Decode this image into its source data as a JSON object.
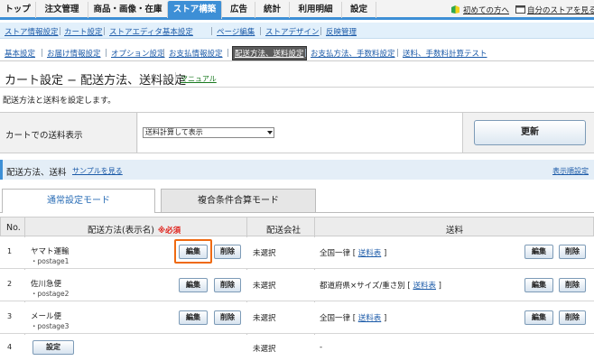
{
  "topnav": {
    "tabs": [
      {
        "label": "トップ"
      },
      {
        "label": "注文管理"
      },
      {
        "label": "商品・画像・在庫"
      },
      {
        "label": "ストア構築"
      },
      {
        "label": "広告"
      },
      {
        "label": "統計"
      },
      {
        "label": "利用明細"
      },
      {
        "label": "設定"
      }
    ],
    "beginner_link": "初めての方へ",
    "view_store_link": "自分のストアを見る"
  },
  "subnav1": {
    "items": [
      {
        "label": "ストア情報設定"
      },
      {
        "label": "カート設定"
      },
      {
        "label": "ストアエディタ基本設定"
      },
      {
        "label": "ページ編集"
      },
      {
        "label": "ストアデザイン"
      },
      {
        "label": "反映管理"
      }
    ]
  },
  "subnav2": {
    "items": [
      {
        "label": "基本設定"
      },
      {
        "label": "お届け情報設定"
      },
      {
        "label": "オプション設定"
      },
      {
        "label": "お支払情報設定"
      },
      {
        "label": "配送方法、送料設定"
      },
      {
        "label": "お支払方法、手数料設定"
      },
      {
        "label": "送料、手数料計算テスト"
      }
    ]
  },
  "page": {
    "title": "カート設定 − 配送方法、送料設定",
    "manual_link": "マニュアル",
    "description": "配送方法と送料を設定します。"
  },
  "display_setting": {
    "label": "カートでの送料表示",
    "selected": "送料計算して表示",
    "update_button": "更新"
  },
  "section": {
    "title": "配送方法、送料",
    "sample_link": "サンプルを見る",
    "order_link": "表示順設定"
  },
  "mode_tabs": {
    "normal": "通常設定モード",
    "compound": "複合条件合算モード"
  },
  "table": {
    "headers": {
      "no": "No.",
      "method": "配送方法(表示名)",
      "required": "※必須",
      "carrier": "配送会社",
      "fee": "送料"
    },
    "edit_label": "編集",
    "delete_label": "削除",
    "set_label": "設定",
    "fee_table_link": "送料表",
    "rows": [
      {
        "no": "1",
        "name": "ヤマト運輸",
        "code": "・postage1",
        "carrier": "未選択",
        "fee_prefix": "全国一律 [ ",
        "fee_suffix": " ]"
      },
      {
        "no": "2",
        "name": "佐川急便",
        "code": "・postage2",
        "carrier": "未選択",
        "fee_prefix": "都道府県×サイズ/重さ別 [ ",
        "fee_suffix": " ]"
      },
      {
        "no": "3",
        "name": "メール便",
        "code": "・postage3",
        "carrier": "未選択",
        "fee_prefix": "全国一律 [ ",
        "fee_suffix": " ]"
      },
      {
        "no": "4",
        "carrier": "未選択",
        "fee_text": "-"
      }
    ]
  },
  "colors": {
    "accent_blue": "#3d8fd6",
    "highlight_orange": "#ef6a12",
    "required_red": "#e0201a"
  }
}
